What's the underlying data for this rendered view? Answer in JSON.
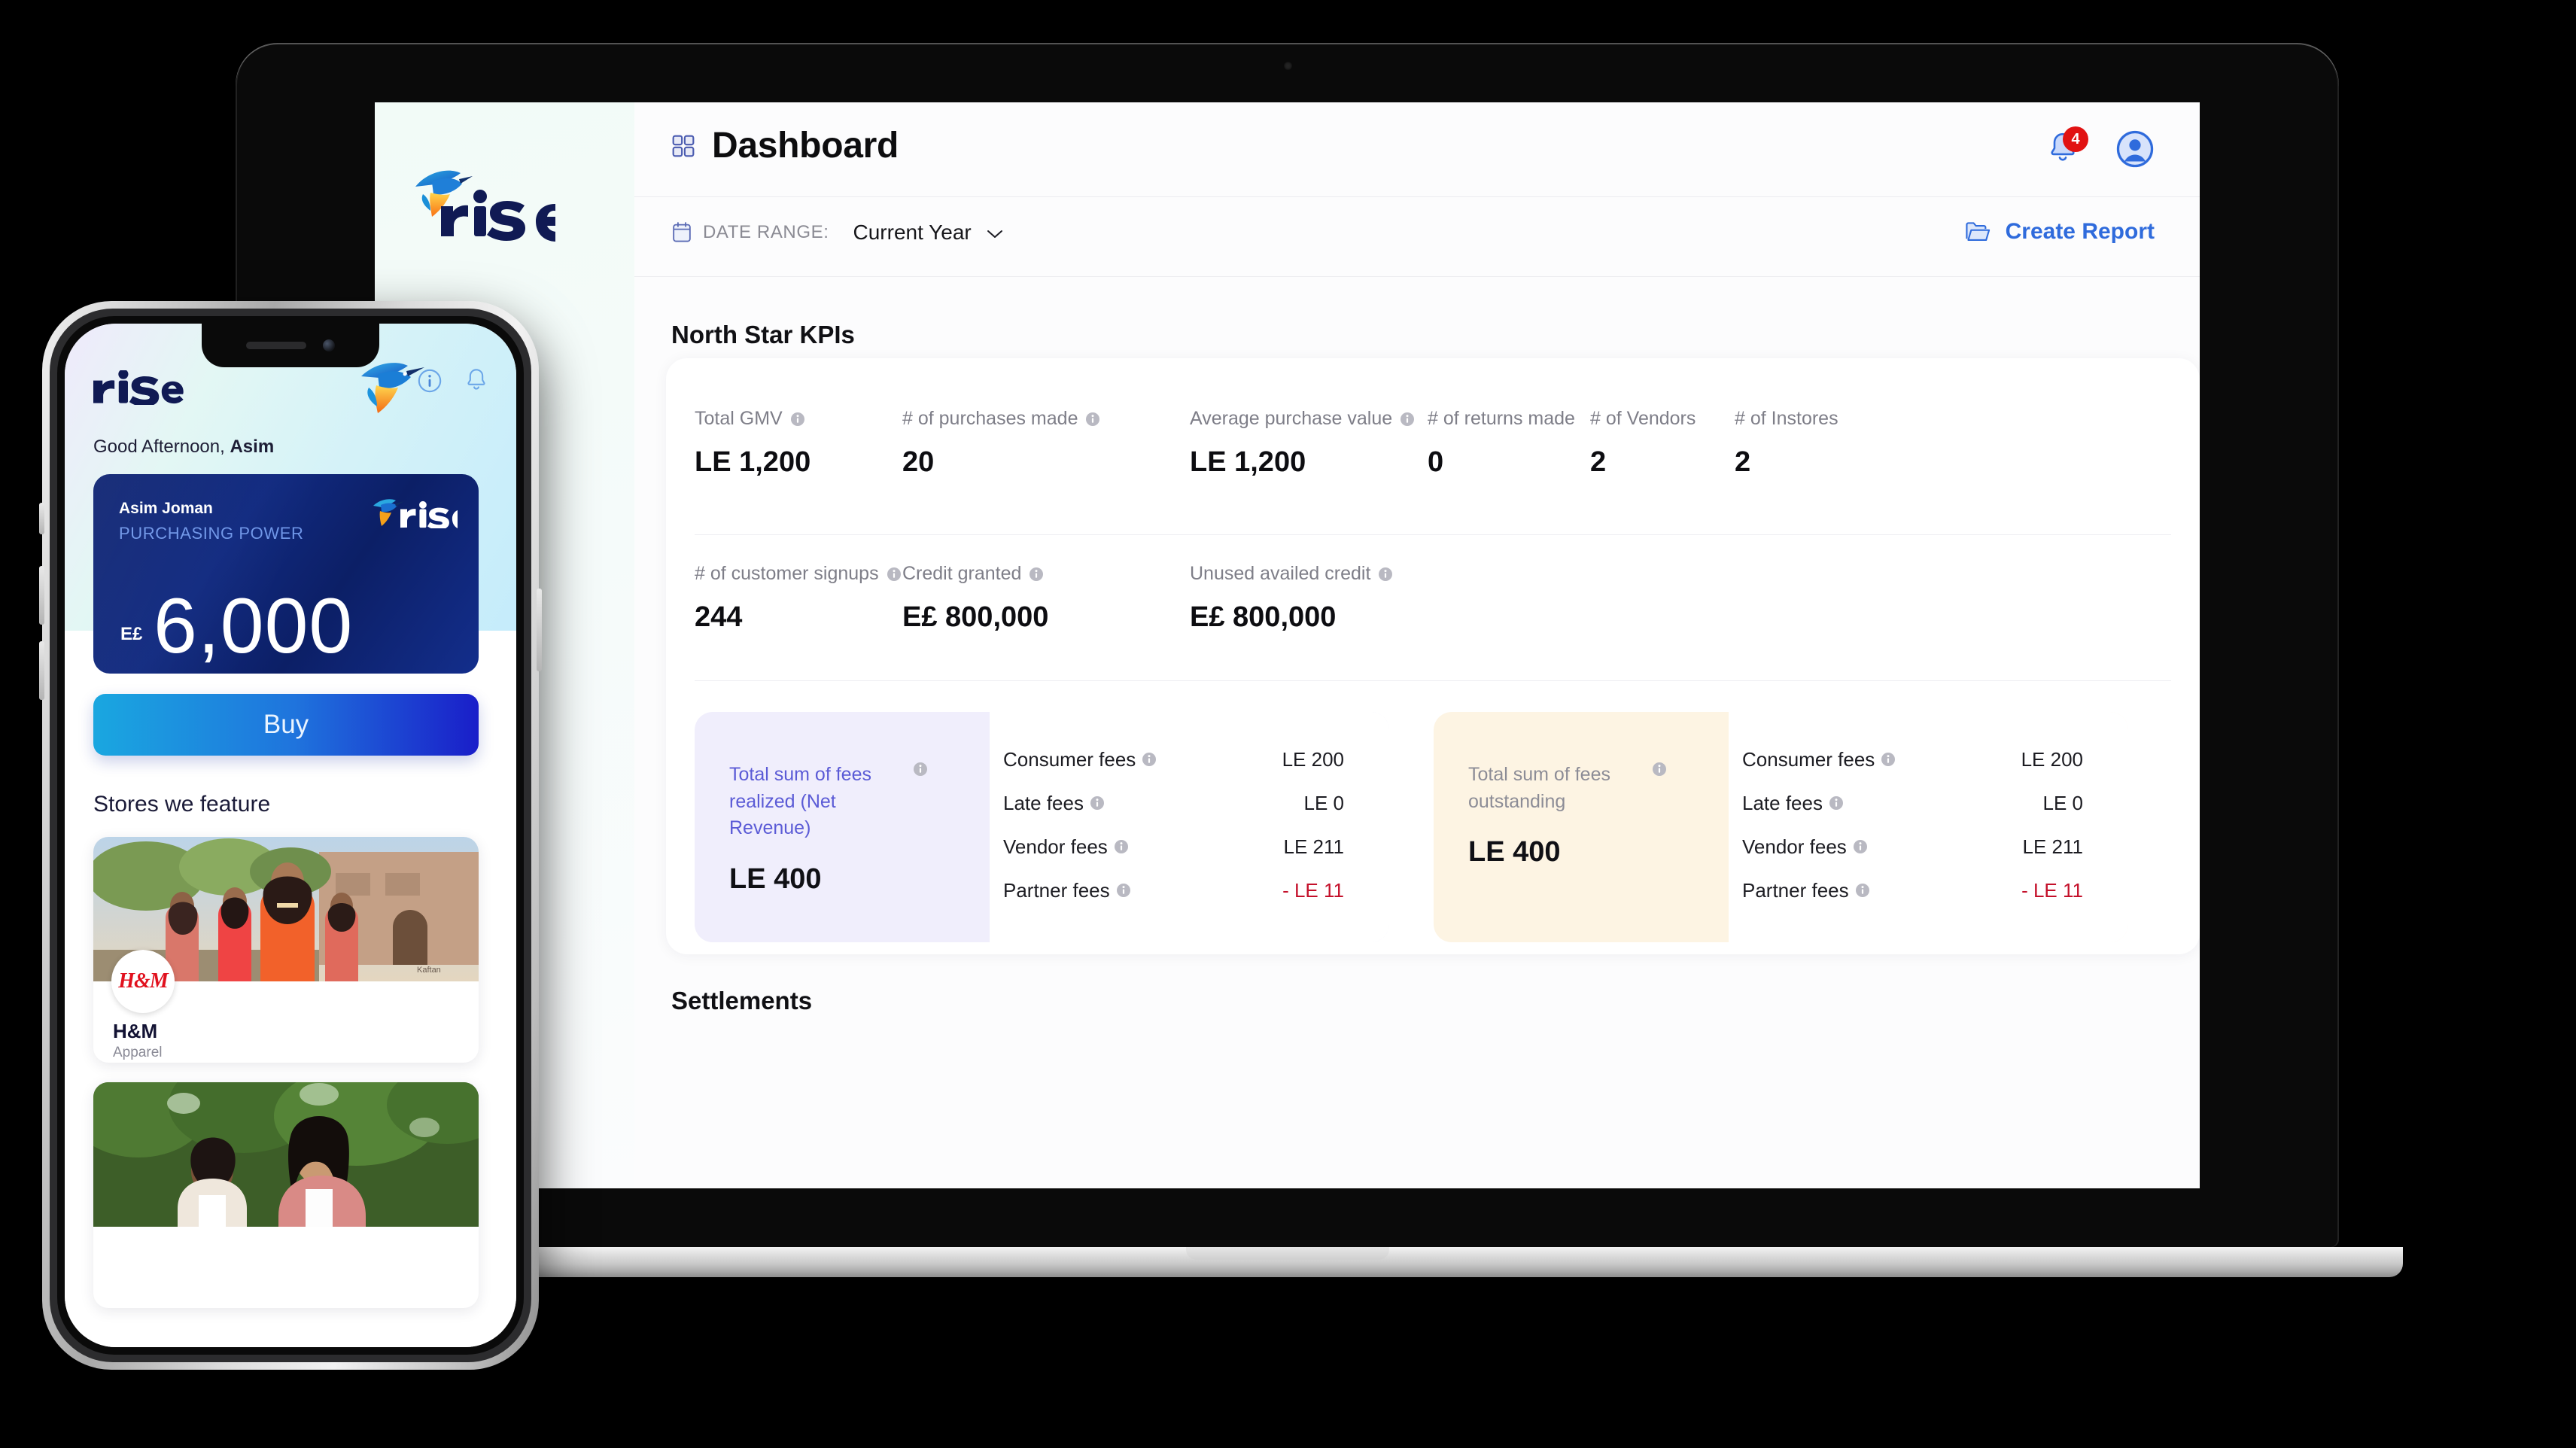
{
  "desktop": {
    "brand": "rise",
    "header": {
      "title": "Dashboard",
      "grid_icon": "grid-icon",
      "bell_icon": "bell-icon",
      "notification_count": "4",
      "avatar_icon": "user-avatar-icon"
    },
    "filters": {
      "calendar_icon": "calendar-icon",
      "date_range_label": "DATE RANGE:",
      "date_range_value": "Current Year",
      "chevron_icon": "chevron-down-icon",
      "create_report_label": "Create Report",
      "folder_icon": "folder-open-icon"
    },
    "sections": {
      "kpi_heading": "North Star KPIs",
      "settlements_heading": "Settlements"
    },
    "kpis_row1": [
      {
        "label": "Total GMV",
        "value": "LE 1,200",
        "info": true
      },
      {
        "label": "# of purchases made",
        "value": "20",
        "info": true
      },
      {
        "label": "Average purchase value",
        "value": "LE 1,200",
        "info": true
      },
      {
        "label": "# of returns made",
        "value": "0",
        "info": false
      },
      {
        "label": "# of Vendors",
        "value": "2",
        "info": false
      },
      {
        "label": "# of Instores",
        "value": "2",
        "info": false
      }
    ],
    "kpis_row2": [
      {
        "label": "# of customer signups",
        "value": "244",
        "info": true
      },
      {
        "label": "Credit granted",
        "value": "E£ 800,000",
        "info": true
      },
      {
        "label": "Unused availed credit",
        "value": "E£ 800,000",
        "info": true
      }
    ],
    "fee_cards": [
      {
        "title": "Total sum of fees realized (Net Revenue)",
        "total": "LE 400",
        "accent": "#5b5bd6",
        "bg": "#f0eefc",
        "lines": [
          {
            "name": "Consumer fees",
            "amount": "LE 200",
            "negative": false
          },
          {
            "name": "Late fees",
            "amount": "LE 0",
            "negative": false
          },
          {
            "name": "Vendor fees",
            "amount": "LE 211",
            "negative": false
          },
          {
            "name": "Partner fees",
            "amount": "- LE 11",
            "negative": true
          }
        ]
      },
      {
        "title": "Total sum of fees outstanding",
        "total": "LE 400",
        "accent": "#8c8c96",
        "bg": "#fdf4e3",
        "lines": [
          {
            "name": "Consumer fees",
            "amount": "LE 200",
            "negative": false
          },
          {
            "name": "Late fees",
            "amount": "LE 0",
            "negative": false
          },
          {
            "name": "Vendor fees",
            "amount": "LE 211",
            "negative": false
          },
          {
            "name": "Partner fees",
            "amount": "- LE 11",
            "negative": true
          }
        ]
      }
    ]
  },
  "phone": {
    "brand": "rise",
    "info_icon": "info-circle-icon",
    "bell_icon": "bell-icon",
    "bird_icon": "hummingbird-icon",
    "greeting_prefix": "Good Afternoon, ",
    "greeting_name": "Asim",
    "card": {
      "holder": "Asim Joman",
      "subtitle": "PURCHASING POWER",
      "currency": "E£",
      "amount": "6,000",
      "logo": "rise"
    },
    "buy_label": "Buy",
    "stores_title": "Stores we feature",
    "stores": [
      {
        "name": "H&M",
        "category": "Apparel",
        "logo_text": "H&M",
        "photo_caption": "Kaftan"
      },
      {
        "name": "",
        "category": "",
        "logo_text": "",
        "photo_caption": ""
      }
    ]
  },
  "colors": {
    "brand_navy": "#0e1a5a",
    "accent_blue": "#2f6bdc",
    "badge_red": "#e11212",
    "negative_red": "#c4102a",
    "purple_card": "#f0eefc",
    "orange_card": "#fdf4e3"
  }
}
